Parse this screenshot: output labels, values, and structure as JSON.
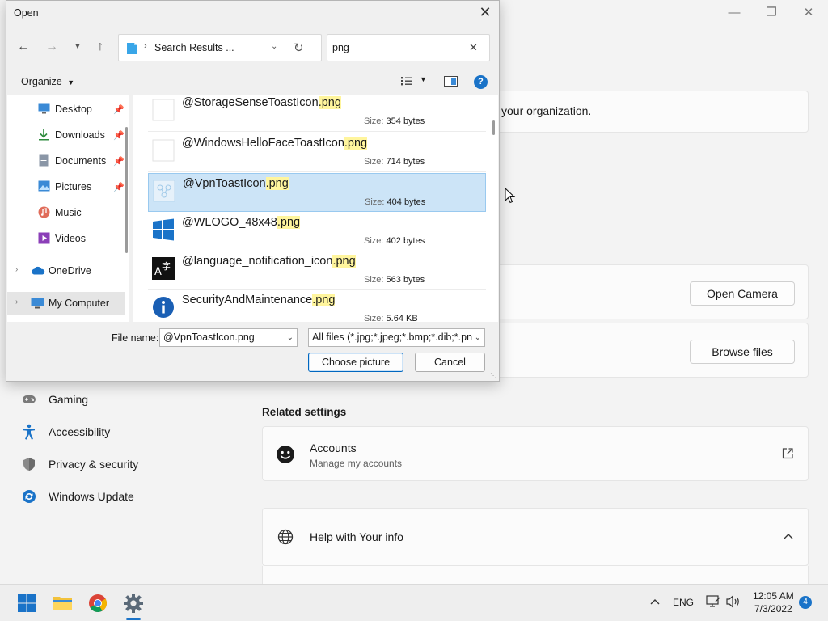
{
  "settings": {
    "org_text": "your organization.",
    "open_camera_label": "Open Camera",
    "browse_files_label": "Browse files",
    "nav_items": [
      {
        "label": "Gaming",
        "icon": "gamepad-icon"
      },
      {
        "label": "Accessibility",
        "icon": "accessibility-icon"
      },
      {
        "label": "Privacy & security",
        "icon": "shield-icon"
      },
      {
        "label": "Windows Update",
        "icon": "windows-update-icon"
      }
    ],
    "related_title": "Related settings",
    "accounts_title": "Accounts",
    "accounts_subtitle": "Manage my accounts",
    "help_title": "Help with Your info"
  },
  "dialog": {
    "title": "Open",
    "address": "Search Results ...",
    "search_value": "png",
    "organize_label": "Organize",
    "nav_pane": [
      {
        "label": "Desktop",
        "icon": "desktop-icon",
        "pinned": true
      },
      {
        "label": "Downloads",
        "icon": "downloads-icon",
        "pinned": true
      },
      {
        "label": "Documents",
        "icon": "documents-icon",
        "pinned": true
      },
      {
        "label": "Pictures",
        "icon": "pictures-icon",
        "pinned": true
      },
      {
        "label": "Music",
        "icon": "music-icon",
        "pinned": false
      },
      {
        "label": "Videos",
        "icon": "videos-icon",
        "pinned": false
      },
      {
        "label": "OneDrive",
        "icon": "onedrive-icon",
        "pinned": false
      },
      {
        "label": "My Computer",
        "icon": "computer-icon",
        "pinned": false
      }
    ],
    "size_label": "Size:",
    "files": [
      {
        "name_base": "@StorageSenseToastIcon",
        "ext": ".png",
        "size": "354 bytes",
        "selected": false,
        "icon": "blank-file-icon"
      },
      {
        "name_base": "@WindowsHelloFaceToastIcon",
        "ext": ".png",
        "size": "714 bytes",
        "selected": false,
        "icon": "blank-file-icon"
      },
      {
        "name_base": "@VpnToastIcon",
        "ext": ".png",
        "size": "404 bytes",
        "selected": true,
        "icon": "vpn-icon"
      },
      {
        "name_base": "@WLOGO_48x48",
        "ext": ".png",
        "size": "402 bytes",
        "selected": false,
        "icon": "windows-logo-icon"
      },
      {
        "name_base": "@language_notification_icon",
        "ext": ".png",
        "size": "563 bytes",
        "selected": false,
        "icon": "language-icon"
      },
      {
        "name_base": "SecurityAndMaintenance",
        "ext": ".png",
        "size": "5.64 KB",
        "selected": false,
        "icon": "info-icon"
      }
    ],
    "file_name_label": "File name:",
    "file_name_value": "@VpnToastIcon.png",
    "file_type_value": "All files (*.jpg;*.jpeg;*.bmp;*.dib;*.png",
    "choose_label": "Choose picture",
    "cancel_label": "Cancel"
  },
  "taskbar": {
    "language": "ENG",
    "time": "12:05 AM",
    "date": "7/3/2022",
    "notification_count": "4"
  }
}
